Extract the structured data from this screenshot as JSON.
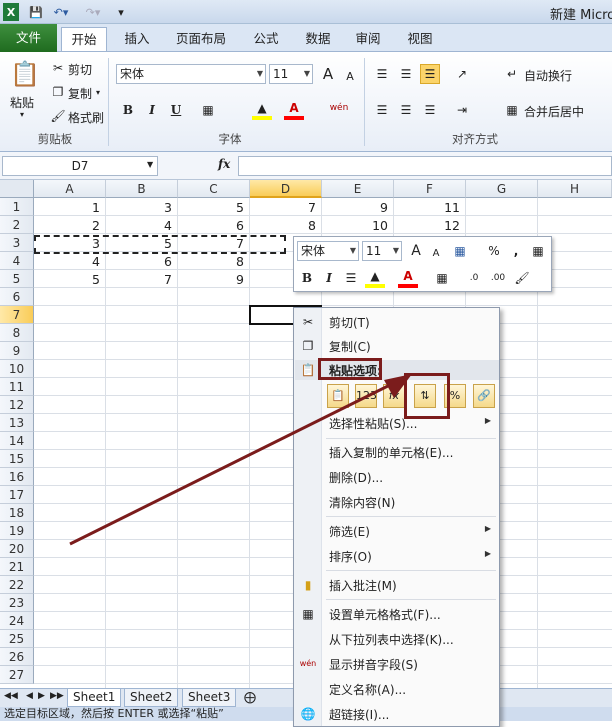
{
  "app": {
    "title": "新建 Micro"
  },
  "ribbon_tabs": [
    "文件",
    "开始",
    "插入",
    "页面布局",
    "公式",
    "数据",
    "审阅",
    "视图"
  ],
  "clipboard": {
    "paste": "粘贴",
    "cut": "剪切",
    "copy": "复制",
    "format_painter": "格式刷",
    "label": "剪贴板"
  },
  "font": {
    "name": "宋体",
    "size": "11",
    "label": "字体",
    "bold": "B",
    "italic": "I",
    "underline": "U",
    "grow": "A",
    "shrink": "A",
    "wen": "wén"
  },
  "alignment": {
    "wrap": "自动换行",
    "merge": "合并后居中",
    "label": "对齐方式"
  },
  "formula_bar": {
    "name_box": "D7",
    "fx": "fx",
    "value": ""
  },
  "columns": [
    "A",
    "B",
    "C",
    "D",
    "E",
    "F",
    "G",
    "H"
  ],
  "rows": [
    "1",
    "2",
    "3",
    "4",
    "5",
    "6",
    "7",
    "8",
    "9",
    "10",
    "11",
    "12",
    "13",
    "14",
    "15",
    "16",
    "17",
    "18",
    "19",
    "20",
    "21",
    "22",
    "23",
    "24",
    "25",
    "26",
    "27"
  ],
  "cells": [
    [
      "1",
      "3",
      "5",
      "7",
      "9",
      "11"
    ],
    [
      "2",
      "4",
      "6",
      "8",
      "10",
      "12"
    ],
    [
      "3",
      "5",
      "7",
      "",
      "",
      ""
    ],
    [
      "4",
      "6",
      "8",
      "",
      "",
      ""
    ],
    [
      "5",
      "7",
      "9",
      "",
      "",
      ""
    ]
  ],
  "mini_toolbar": {
    "font": "宋体",
    "size": "11",
    "bold": "B",
    "italic": "I",
    "percent": "%",
    "comma": ",",
    "grow": "A",
    "shrink": "A"
  },
  "context_menu": {
    "cut": "剪切(T)",
    "copy": "复制(C)",
    "paste_options": "粘贴选项:",
    "paste_special": "选择性粘贴(S)...",
    "insert_copied": "插入复制的单元格(E)...",
    "delete": "删除(D)...",
    "clear": "清除内容(N)",
    "filter": "筛选(E)",
    "sort": "排序(O)",
    "insert_comment": "插入批注(M)",
    "format_cells": "设置单元格格式(F)...",
    "pick_list": "从下拉列表中选择(K)...",
    "phonetic": "显示拼音字段(S)",
    "define_name": "定义名称(A)...",
    "hyperlink": "超链接(I)..."
  },
  "sheets": [
    "Sheet1",
    "Sheet2",
    "Sheet3"
  ],
  "status": "选定目标区域，然后按 ENTER 或选择“粘贴”",
  "colors": {
    "accent": "#7b1c1c",
    "file_tab": "#2a7a2a"
  }
}
